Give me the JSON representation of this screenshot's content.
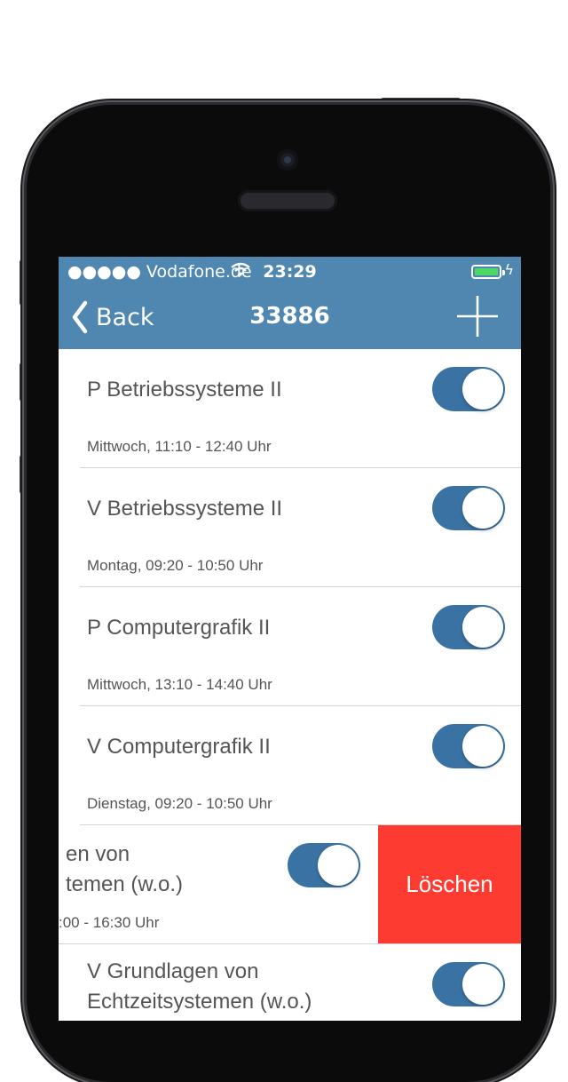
{
  "status_bar": {
    "carrier": "●●●●● Vodafone.de",
    "time": "23:29",
    "battery_color": "#4cd964"
  },
  "nav": {
    "back_label": "Back",
    "title": "33886",
    "accent": "#4f87b0"
  },
  "items": [
    {
      "name": "P Betriebssysteme II",
      "meta": "Mittwoch, 11:10 - 12:40 Uhr",
      "toggle_on": true
    },
    {
      "name": "V Betriebssysteme II",
      "meta": "Montag, 09:20 - 10:50 Uhr",
      "toggle_on": true
    },
    {
      "name": "P Computergrafik II",
      "meta": "Mittwoch, 13:10 - 14:40 Uhr",
      "toggle_on": true
    },
    {
      "name": "V Computergrafik II",
      "meta": "Dienstag, 09:20 - 10:50 Uhr",
      "toggle_on": true
    }
  ],
  "swiped_item": {
    "name_line1": "en von",
    "name_line2": "temen (w.o.)",
    "meta": ":00 - 16:30 Uhr",
    "toggle_on": true,
    "delete_label": "Löschen"
  },
  "last_item": {
    "name_line1": "V Grundlagen von",
    "name_line2": "Echtzeitsystemen (w.o.)",
    "toggle_on": true
  }
}
